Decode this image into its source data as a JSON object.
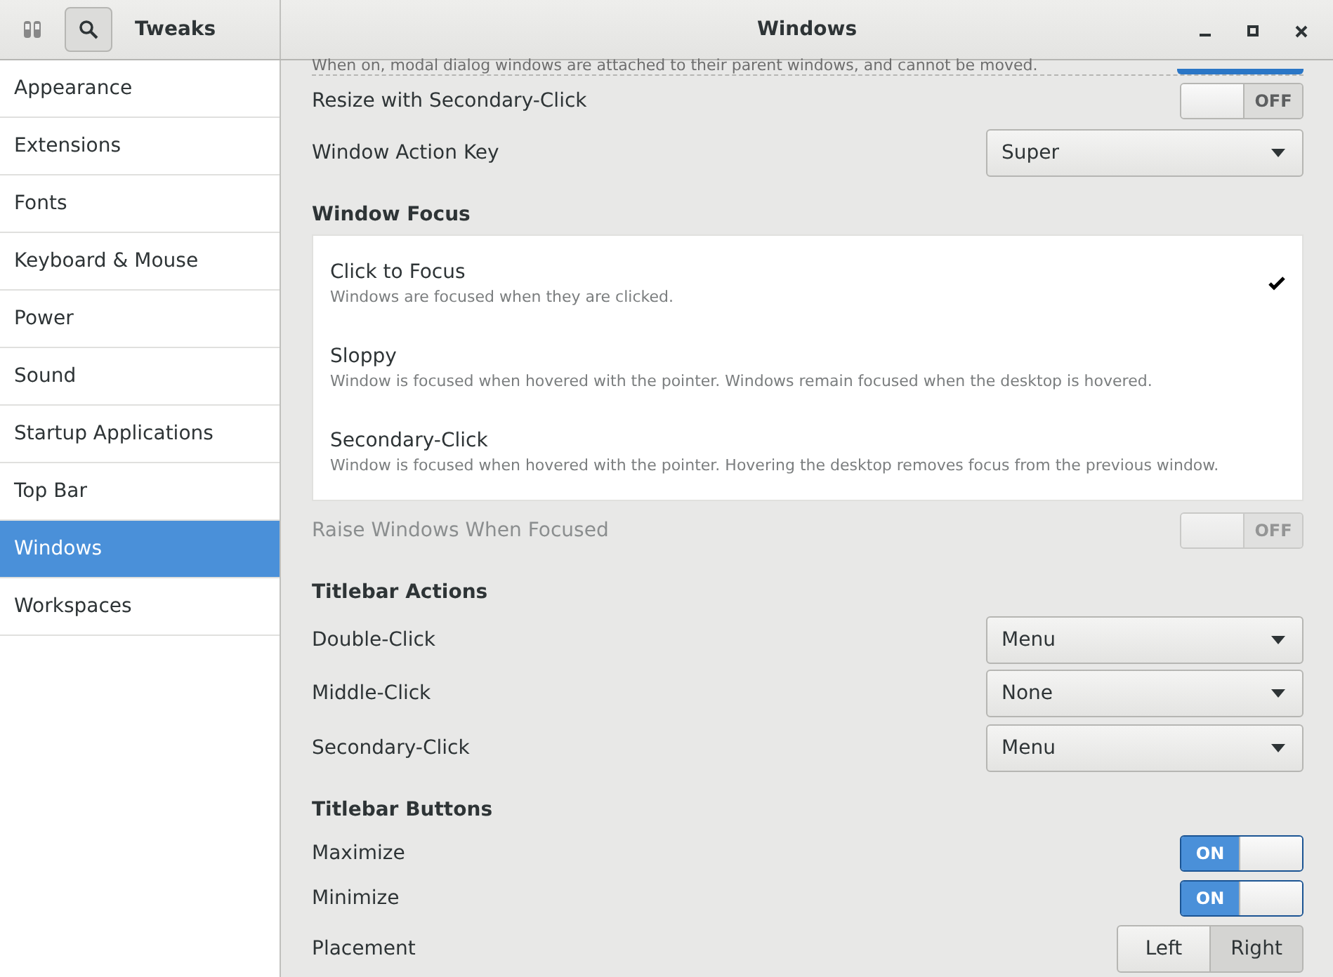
{
  "header": {
    "app_title": "Tweaks",
    "page_title": "Windows"
  },
  "sidebar": {
    "items": [
      {
        "label": "Appearance",
        "selected": false
      },
      {
        "label": "Extensions",
        "selected": false
      },
      {
        "label": "Fonts",
        "selected": false
      },
      {
        "label": "Keyboard & Mouse",
        "selected": false
      },
      {
        "label": "Power",
        "selected": false
      },
      {
        "label": "Sound",
        "selected": false
      },
      {
        "label": "Startup Applications",
        "selected": false
      },
      {
        "label": "Top Bar",
        "selected": false
      },
      {
        "label": "Windows",
        "selected": true
      },
      {
        "label": "Workspaces",
        "selected": false
      }
    ]
  },
  "content": [
    {
      "kind": "cut",
      "text": "When on, modal dialog windows are attached to their parent windows, and cannot be moved.",
      "on": true
    },
    {
      "kind": "switch",
      "label": "Resize with Secondary-Click",
      "on": false,
      "disabled": false,
      "state_text": "OFF"
    },
    {
      "kind": "dropdown",
      "label": "Window Action Key",
      "value": "Super"
    },
    {
      "kind": "heading",
      "text": "Window Focus"
    },
    {
      "kind": "choices",
      "items": [
        {
          "title": "Click to Focus",
          "description": "Windows are focused when they are clicked.",
          "selected": true
        },
        {
          "title": "Sloppy",
          "description": "Window is focused when hovered with the pointer. Windows remain focused when the desktop is hovered.",
          "selected": false
        },
        {
          "title": "Secondary-Click",
          "description": "Window is focused when hovered with the pointer. Hovering the desktop removes focus from the previous window.",
          "selected": false
        }
      ]
    },
    {
      "kind": "switch",
      "label": "Raise Windows When Focused",
      "on": false,
      "disabled": true,
      "state_text": "OFF"
    },
    {
      "kind": "heading",
      "text": "Titlebar Actions"
    },
    {
      "kind": "dropdown",
      "label": "Double-Click",
      "value": "Menu"
    },
    {
      "kind": "dropdown",
      "label": "Middle-Click",
      "value": "None"
    },
    {
      "kind": "dropdown",
      "label": "Secondary-Click",
      "value": "Menu"
    },
    {
      "kind": "heading",
      "text": "Titlebar Buttons"
    },
    {
      "kind": "switch",
      "label": "Maximize",
      "on": true,
      "disabled": false,
      "state_text": "ON"
    },
    {
      "kind": "switch",
      "label": "Minimize",
      "on": true,
      "disabled": false,
      "state_text": "ON"
    },
    {
      "kind": "segments",
      "label": "Placement",
      "options": [
        {
          "label": "Left",
          "selected": false
        },
        {
          "label": "Right",
          "selected": true
        }
      ]
    }
  ]
}
